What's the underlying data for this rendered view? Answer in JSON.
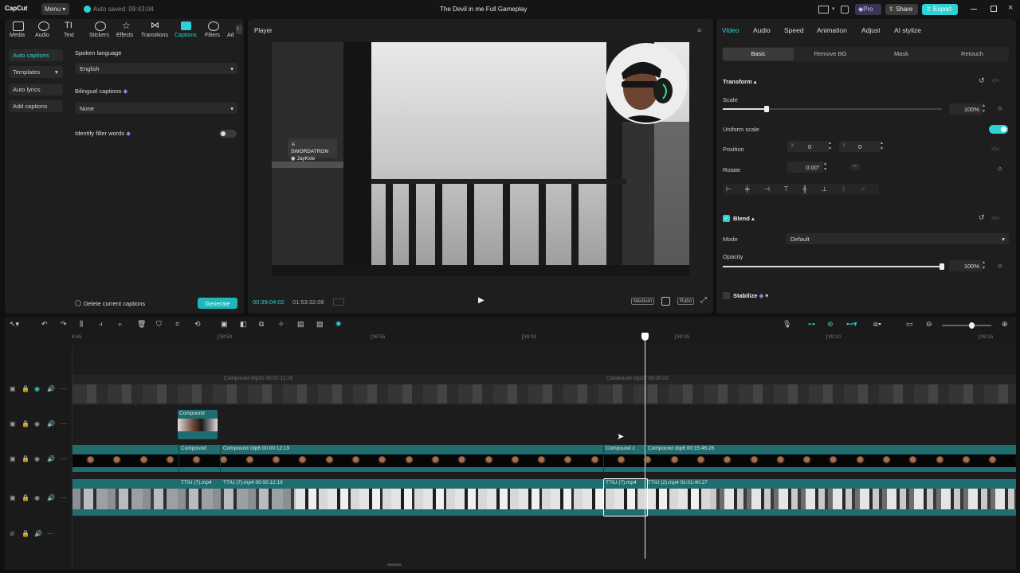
{
  "app": {
    "logo": "CapCut",
    "menu_label": "Menu",
    "autosave": "Auto saved: 09:43:04",
    "project_title": "The Devil in me Full Gameplay",
    "pro_label": "Pro",
    "share_label": "Share",
    "export_label": "Export"
  },
  "media_tabs": [
    "Media",
    "Audio",
    "Text",
    "Stickers",
    "Effects",
    "Transitions",
    "Captions",
    "Filters",
    "Ad"
  ],
  "captions": {
    "nav": [
      "Auto captions",
      "Templates",
      "Auto lyrics",
      "Add captions"
    ],
    "spoken_language_label": "Spoken language",
    "spoken_language_value": "English",
    "bilingual_label": "Bilingual captions",
    "bilingual_value": "None",
    "filler_label": "Identify filler words",
    "delete_label": "Delete current captions",
    "generate_label": "Generate"
  },
  "player": {
    "title": "Player",
    "current_time": "00:39:04:02",
    "total_time": "01:53:32:06",
    "quality": "Medium",
    "ratio": "Ratio",
    "overlay_line1": "SWORDATRON",
    "overlay_line2": "JayKxle"
  },
  "inspector": {
    "tabs": [
      "Video",
      "Audio",
      "Speed",
      "Animation",
      "Adjust",
      "AI stylize"
    ],
    "subtabs": [
      "Basic",
      "Remove BG",
      "Mask",
      "Retouch"
    ],
    "transform_label": "Transform",
    "scale_label": "Scale",
    "scale_value": "100%",
    "scale_fraction": 0.2,
    "uniform_scale_label": "Uniform scale",
    "position_label": "Position",
    "pos_x_label": "X",
    "pos_x": "0",
    "pos_y_label": "Y",
    "pos_y": "0",
    "rotate_label": "Rotate",
    "rotate_value": "0.00°",
    "rotate_dash": "–",
    "blend_label": "Blend",
    "mode_label": "Mode",
    "mode_value": "Default",
    "opacity_label": "Opacity",
    "opacity_value": "100%",
    "opacity_fraction": 1.0,
    "stabilize_label": "Stabilize"
  },
  "timeline": {
    "ruler": [
      "8:45",
      "38:50",
      "38:55",
      "39:00",
      "39:05",
      "39:10",
      "39:15"
    ],
    "clips": {
      "faded1": "Compound clip21  00:02:11:19",
      "faded2": "Compound clip22  00:20:22",
      "compound_small": "Compound",
      "c1a": "Compound",
      "c1b": "Compound clip6  00:00:12:19",
      "c1c": "Compound c",
      "c1d": "Compound clip6  00:15:46:26",
      "v1a": "TTIU (7).mp4",
      "v1b": "TTIU (7).mp4  00:00:12:19",
      "v1c": "TTIU (7).mp4",
      "v1d": "TTIU (2).mp4  01:01:40:27"
    }
  },
  "colors": {
    "accent": "#2ed1d6",
    "clip": "#1f6d6e"
  }
}
